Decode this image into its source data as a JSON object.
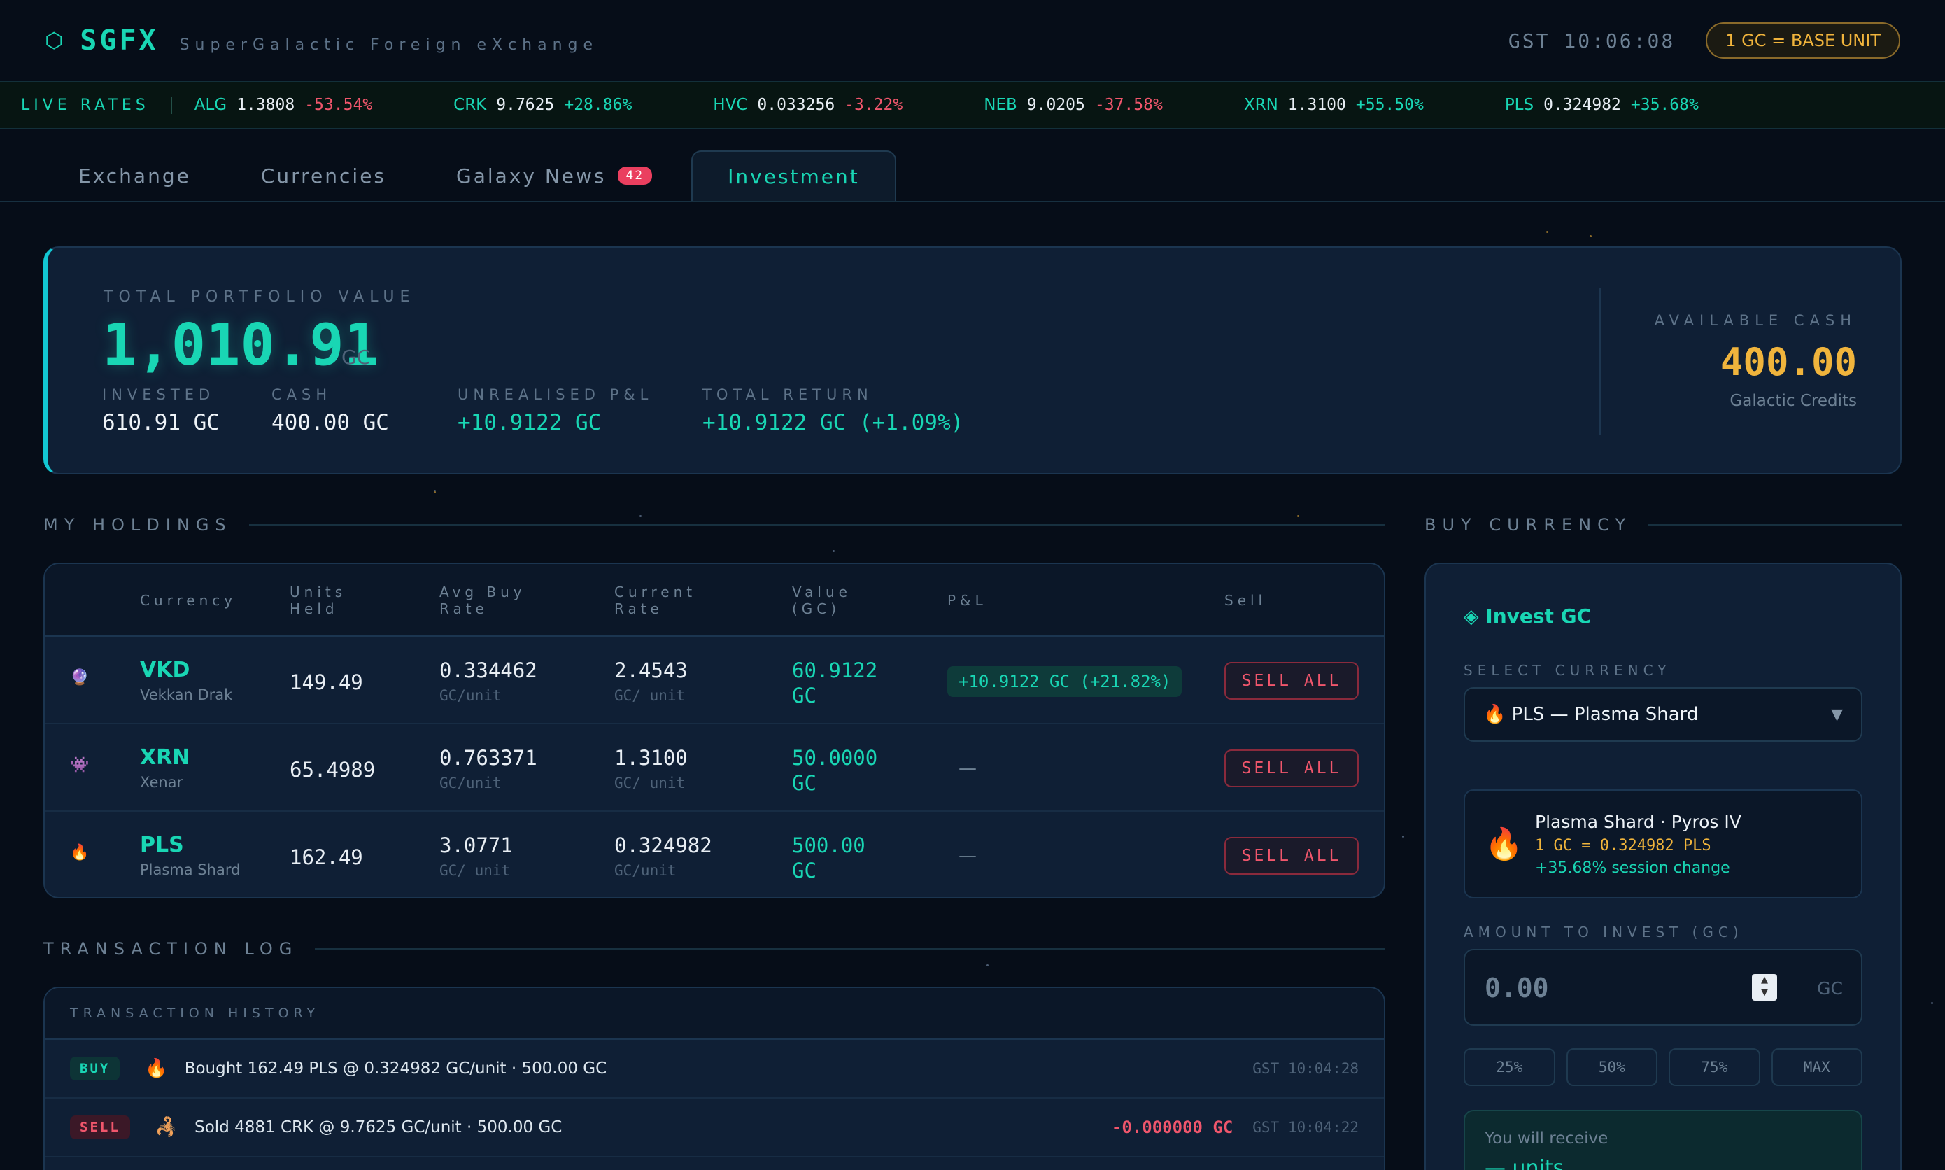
{
  "header": {
    "logo_mark": "⬡",
    "logo": "SGFX",
    "subtitle": "SuperGalactic Foreign eXchange",
    "clock": "GST 10:06:08",
    "base_unit": "1 GC = BASE UNIT"
  },
  "ticker": {
    "label": "LIVE RATES",
    "items": [
      {
        "sym": "ALG",
        "rate": "1.3808",
        "change": "-53.54%",
        "dir": "neg"
      },
      {
        "sym": "CRK",
        "rate": "9.7625",
        "change": "+28.86%",
        "dir": "pos"
      },
      {
        "sym": "HVC",
        "rate": "0.033256",
        "change": "-3.22%",
        "dir": "neg"
      },
      {
        "sym": "NEB",
        "rate": "9.0205",
        "change": "-37.58%",
        "dir": "neg"
      },
      {
        "sym": "XRN",
        "rate": "1.3100",
        "change": "+55.50%",
        "dir": "pos"
      },
      {
        "sym": "PLS",
        "rate": "0.324982",
        "change": "+35.68%",
        "dir": "pos"
      }
    ]
  },
  "tabs": {
    "exchange": "Exchange",
    "currencies": "Currencies",
    "news": "Galaxy News",
    "news_badge": "42",
    "investment": "Investment"
  },
  "portfolio": {
    "label": "TOTAL PORTFOLIO VALUE",
    "value": "1,010.91",
    "unit": "GC",
    "invested_label": "INVESTED",
    "invested": "610.91 GC",
    "cash_label": "CASH",
    "cash": "400.00 GC",
    "pnl_label": "UNREALISED P&L",
    "pnl": "+10.9122 GC",
    "return_label": "TOTAL RETURN",
    "return": "+10.9122 GC (+1.09%)",
    "available_label": "AVAILABLE CASH",
    "available": "400.00",
    "available_sub": "Galactic Credits"
  },
  "holdings": {
    "title": "MY HOLDINGS",
    "columns": {
      "currency": "Currency",
      "units_1": "Units",
      "units_2": "Held",
      "avg_1": "Avg Buy",
      "avg_2": "Rate",
      "cur_1": "Current",
      "cur_2": "Rate",
      "val_1": "Value",
      "val_2": "(GC)",
      "pnl": "P&L",
      "sell": "Sell"
    },
    "sell_label": "SELL ALL",
    "dash": "—",
    "rows": [
      {
        "icon": "🔮",
        "sym": "VKD",
        "name": "Vekkan Drak",
        "units": "149.49",
        "avg": "0.334462",
        "avg_unit": "GC/unit",
        "cur": "2.4543",
        "cur_unit": "GC/ unit",
        "val_1": "60.9122",
        "val_2": "GC",
        "pnl": "+10.9122 GC (+21.82%)"
      },
      {
        "icon": "👾",
        "sym": "XRN",
        "name": "Xenar",
        "units": "65.4989",
        "avg": "0.763371",
        "avg_unit": "GC/unit",
        "cur": "1.3100",
        "cur_unit": "GC/ unit",
        "val_1": "50.0000",
        "val_2": "GC",
        "pnl": ""
      },
      {
        "icon": "🔥",
        "sym": "PLS",
        "name": "Plasma Shard",
        "units": "162.49",
        "avg": "3.0771",
        "avg_unit": "GC/ unit",
        "cur": "0.324982",
        "cur_unit": "GC/unit",
        "val_1": "500.00",
        "val_2": "GC",
        "pnl": ""
      }
    ]
  },
  "txlog": {
    "title": "TRANSACTION LOG",
    "header": "TRANSACTION HISTORY",
    "rows": [
      {
        "type": "BUY",
        "icon": "🔥",
        "text": "Bought 162.49 PLS @ 0.324982 GC/unit · 500.00 GC",
        "amount": "",
        "time": "GST 10:04:28"
      },
      {
        "type": "SELL",
        "icon": "🦂",
        "text": "Sold 4881 CRK @ 9.7625 GC/unit · 500.00 GC",
        "amount": "-0.000000 GC",
        "time": "GST 10:04:22"
      }
    ]
  },
  "buy": {
    "section": "BUY CURRENCY",
    "title": "◈ Invest GC",
    "select_label": "SELECT CURRENCY",
    "selected": "🔥 PLS — Plasma Shard",
    "caret": "▼",
    "info_icon": "🔥",
    "info_title": "Plasma Shard · Pyros IV",
    "info_rate": "1 GC = 0.324982 PLS",
    "info_change": "+35.68% session change",
    "amount_label": "AMOUNT TO INVEST (GC)",
    "amount": "0.00",
    "amount_unit": "GC",
    "pct": [
      "25%",
      "50%",
      "75%",
      "MAX"
    ],
    "receive_label": "You will receive",
    "receive_value": "— units"
  },
  "colors": {
    "accent": "#19d6b4",
    "gold": "#f0b43c",
    "negative": "#f0566c",
    "background": "#060d18",
    "panel": "#0f1f35"
  }
}
